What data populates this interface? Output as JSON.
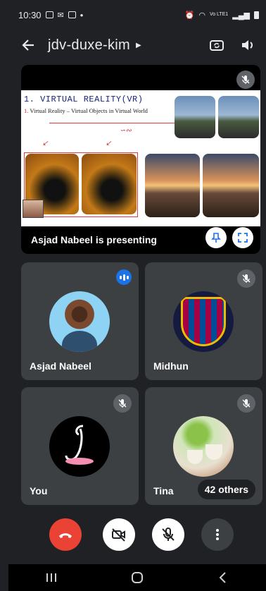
{
  "status_bar": {
    "time": "10:30",
    "dot": "•",
    "network": "Vo LTE1"
  },
  "header": {
    "meeting_code": "jdv-duxe-kim"
  },
  "presentation": {
    "slide_title": "1. VIRTUAL REALITY(VR)",
    "slide_number": "1.",
    "slide_subtitle": "Virtual Reality – Virtual Objects in Virtual World",
    "presenting_text": "Asjad Nabeel is presenting"
  },
  "participants": [
    {
      "name": "Asjad Nabeel",
      "state": "speaking"
    },
    {
      "name": "Midhun",
      "state": "muted"
    },
    {
      "name": "You",
      "state": "muted"
    },
    {
      "name": "Tina",
      "state": "muted"
    }
  ],
  "others_badge": "42 others",
  "colors": {
    "end_call": "#ea4335",
    "speaking": "#1a73e8",
    "tile": "#3c4043",
    "background": "#202124"
  }
}
